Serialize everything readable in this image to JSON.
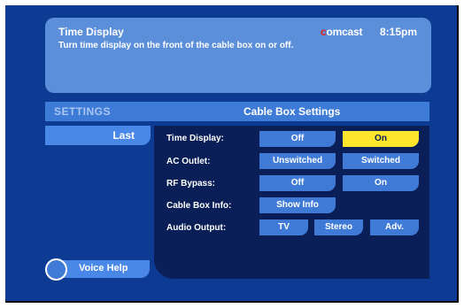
{
  "info": {
    "title": "Time Display",
    "description": "Turn time display on the front of the cable box on or off.",
    "brand_c": "c",
    "brand_rest": "omcast",
    "time": "8:15pm"
  },
  "settings": {
    "label": "SETTINGS",
    "title": "Cable Box Settings"
  },
  "nav": {
    "last_label": "Last",
    "voice_help_label": "Voice Help"
  },
  "rows": [
    {
      "label": "Time Display:",
      "options": [
        "Off",
        "On"
      ],
      "selected": "On"
    },
    {
      "label": "AC Outlet:",
      "options": [
        "Unswitched",
        "Switched"
      ]
    },
    {
      "label": "RF Bypass:",
      "options": [
        "Off",
        "On"
      ]
    },
    {
      "label": "Cable Box Info:",
      "options": [
        "Show Info"
      ]
    },
    {
      "label": "Audio Output:",
      "options": [
        "TV",
        "Stereo",
        "Adv."
      ]
    }
  ],
  "colors": {
    "background": "#0d3a92",
    "panel": "#5b8fd9",
    "button": "#3f7bd6",
    "selected": "#ffe52b",
    "options_bg": "#0a1f57",
    "brand_accent": "#e02020"
  }
}
